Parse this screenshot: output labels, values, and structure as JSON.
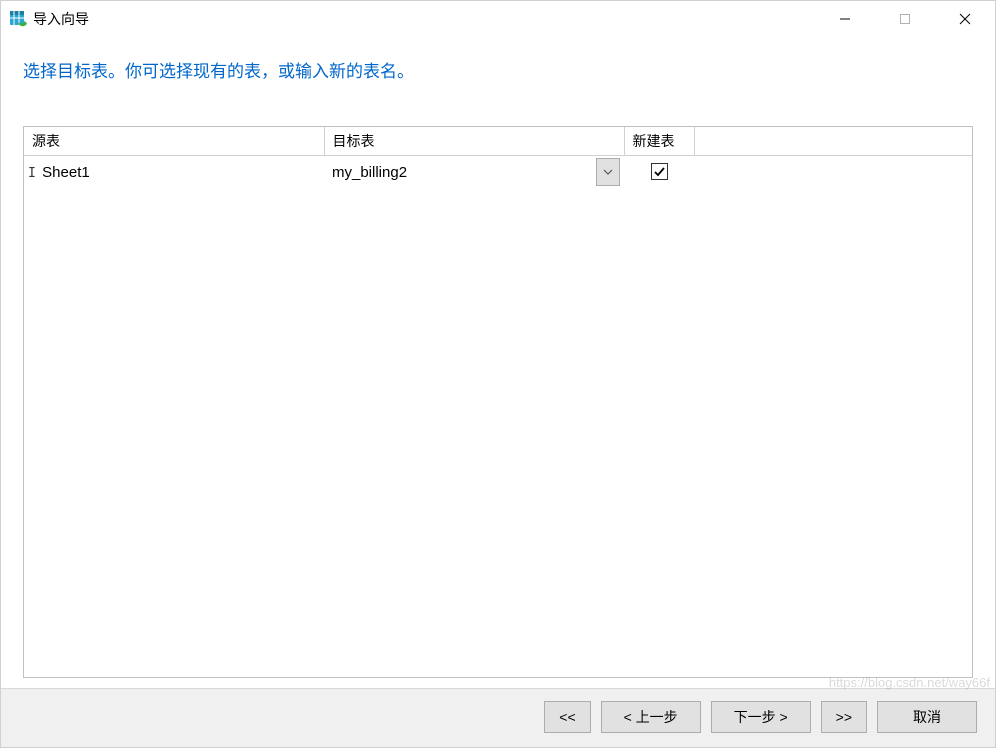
{
  "window": {
    "title": "导入向导"
  },
  "instruction": "选择目标表。你可选择现有的表，或输入新的表名。",
  "table": {
    "headers": {
      "source": "源表",
      "target": "目标表",
      "new": "新建表"
    },
    "row": {
      "source": "Sheet1",
      "target": "my_billing2",
      "new_checked": true
    }
  },
  "footer": {
    "first": "<<",
    "prev": "< 上一步",
    "next": "下一步 >",
    "last": ">>",
    "cancel": "取消"
  },
  "watermark": "https://blog.csdn.net/way66f"
}
